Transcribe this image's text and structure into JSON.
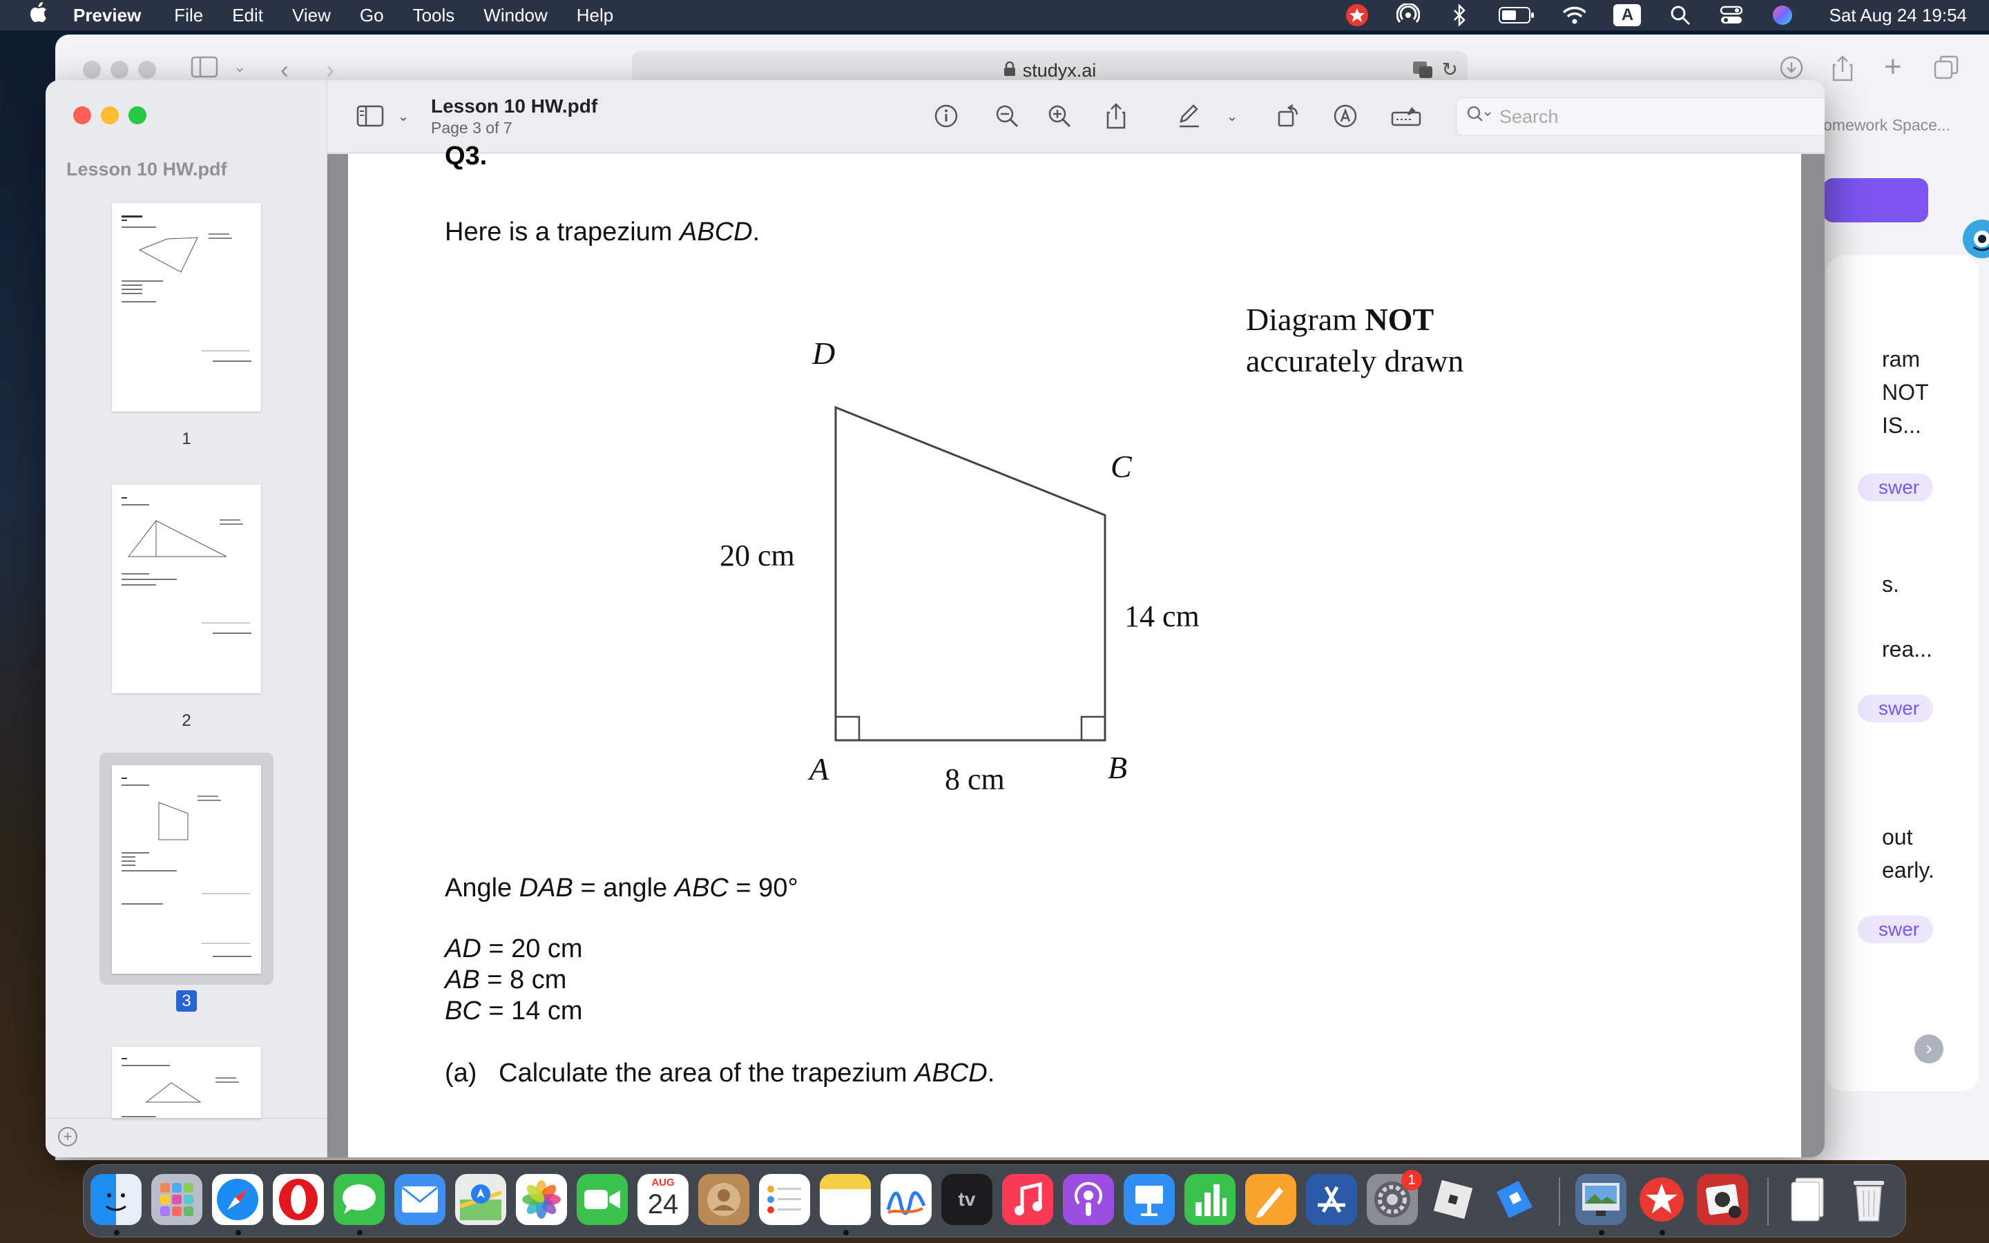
{
  "menubar": {
    "app_name": "Preview",
    "items": [
      "File",
      "Edit",
      "View",
      "Go",
      "Tools",
      "Window",
      "Help"
    ],
    "keyboard_indicator": "A",
    "datetime": "Sat Aug 24  19:54"
  },
  "safari": {
    "url": "studyx.ai",
    "breadcrumb": "omework Space...",
    "partial_texts": [
      "ram",
      "NOT",
      "IS...",
      "s.",
      "rea...",
      "out",
      "early."
    ],
    "answer_pill": "swer"
  },
  "preview": {
    "file_name": "Lesson 10 HW.pdf",
    "page_info": "Page 3 of 7",
    "sidebar_title": "Lesson 10 HW.pdf",
    "search_placeholder": "Search",
    "thumbnails": [
      "1",
      "2",
      "3"
    ],
    "selected_page": "3"
  },
  "document": {
    "question_head": "Q3.",
    "intro": "Here is a trapezium ",
    "intro_shape": "ABCD",
    "intro_end": ".",
    "diagram_note_line1": "Diagram ",
    "diagram_note_bold": "NOT",
    "diagram_note_line2": "accurately drawn",
    "vertices": {
      "A": "A",
      "B": "B",
      "C": "C",
      "D": "D"
    },
    "labels": {
      "ad": "20 cm",
      "bc": "14 cm",
      "ab": "8 cm"
    },
    "angle_line": {
      "p1": "Angle ",
      "a1": "DAB",
      "p2": " = angle ",
      "a2": "ABC",
      "p3": " = 90°"
    },
    "facts": [
      {
        "name": "AD",
        "value": " = 20 cm"
      },
      {
        "name": "AB",
        "value": " = 8 cm"
      },
      {
        "name": "BC",
        "value": " = 14 cm"
      }
    ],
    "part_a": {
      "label": "(a)",
      "text": "Calculate the area of the trapezium ",
      "shape": "ABCD",
      "end": "."
    }
  },
  "dock": {
    "calendar_month": "AUG",
    "calendar_day": "24",
    "settings_badge": "1",
    "tv_label": "tv"
  }
}
